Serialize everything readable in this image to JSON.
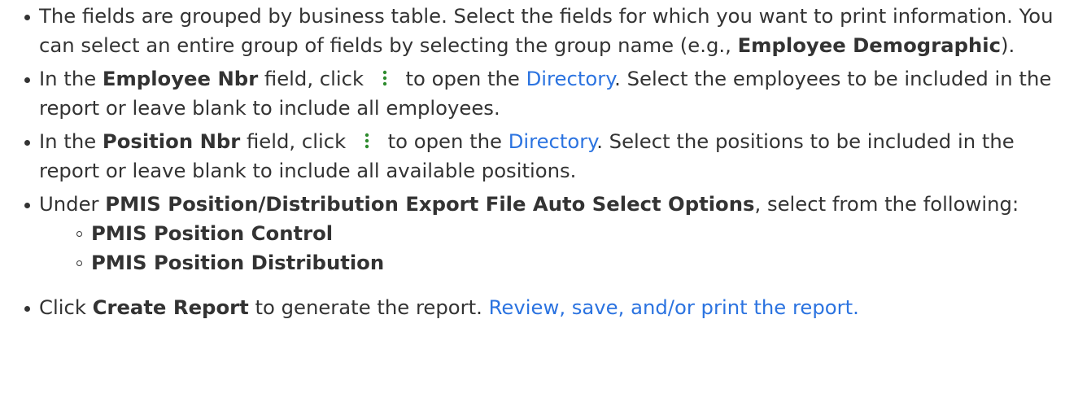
{
  "items": [
    {
      "t1": "The fields are grouped by business table. Select the fields for which you want to print information. You can select an entire group of fields by selecting the group name (e.g., ",
      "b1": "Employee Demographic",
      "t2": ")."
    },
    {
      "t1": "In the ",
      "b1": "Employee Nbr",
      "t2": " field, click ",
      "icon": "vertical-dots-icon",
      "t3": " to open the ",
      "link": "Directory",
      "t4": ". Select the employees to be included in the report or leave blank to include all employees."
    },
    {
      "t1": "In the ",
      "b1": "Position Nbr",
      "t2": " field, click ",
      "icon": "vertical-dots-icon",
      "t3": " to open the ",
      "link": "Directory",
      "t4": ". Select the positions to be included in the report or leave blank to include all available positions."
    },
    {
      "t1": "Under ",
      "b1": "PMIS Position/Distribution Export File Auto Select Options",
      "t2": ", select from the following:",
      "sub": [
        "PMIS Position Control",
        "PMIS Position Distribution"
      ]
    },
    {
      "t1": "Click ",
      "b1": "Create Report",
      "t2": " to generate the report. ",
      "link": "Review, save, and/or print the report."
    }
  ],
  "colors": {
    "text": "#333333",
    "link": "#2b73e0",
    "icon": "#2e8b2e"
  }
}
